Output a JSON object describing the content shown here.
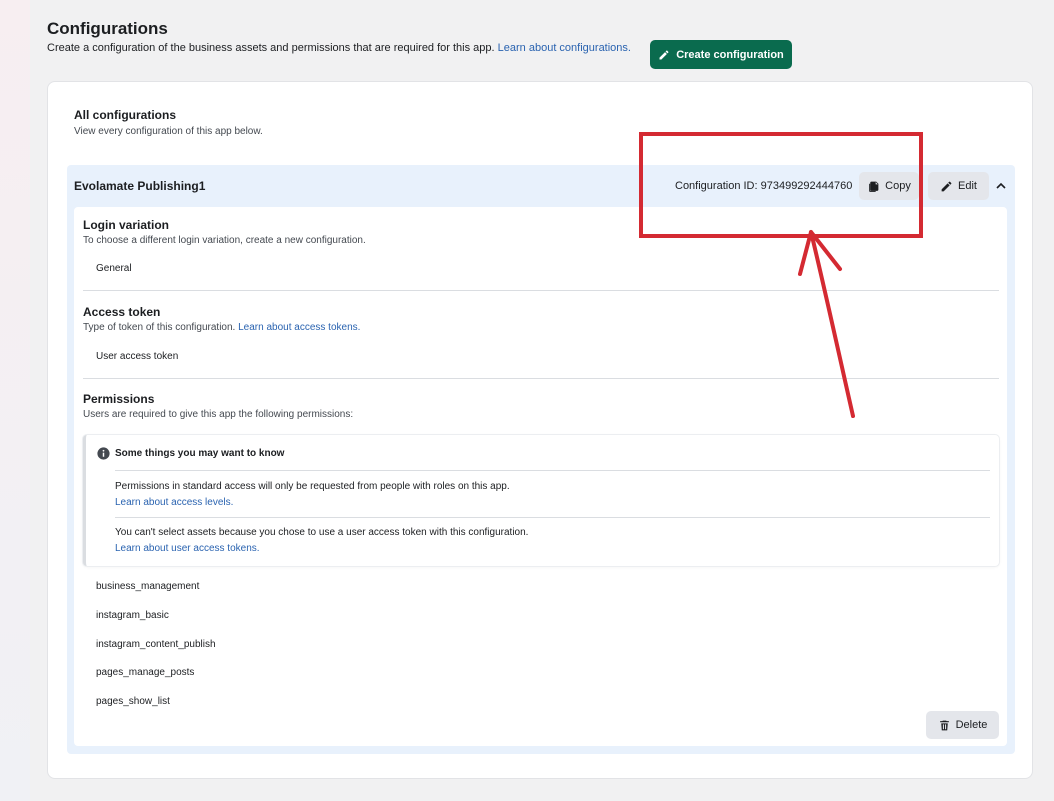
{
  "header": {
    "title": "Configurations",
    "subtitle": "Create a configuration of the business assets and permissions that are required for this app.",
    "subtitle_link": "Learn about configurations.",
    "create_button": "Create configuration"
  },
  "all_configurations": {
    "title": "All configurations",
    "subtitle": "View every configuration of this app below."
  },
  "configuration": {
    "name": "Evolamate Publishing1",
    "id_text": "Configuration ID: 973499292444760",
    "copy_label": "Copy",
    "edit_label": "Edit",
    "login": {
      "title": "Login variation",
      "desc": "To choose a different login variation, create a new configuration.",
      "value": "General"
    },
    "access_token": {
      "title": "Access token",
      "desc": "Type of token of this configuration.",
      "desc_link": "Learn about access tokens.",
      "value": "User access token"
    },
    "permissions": {
      "title": "Permissions",
      "desc": "Users are required to give this app the following permissions:",
      "notice": {
        "title": "Some things you may want to know",
        "item1_text": "Permissions in standard access will only be requested from people with roles on this app.",
        "item1_link": "Learn about access levels.",
        "item2_text": "You can't select assets because you chose to use a user access token with this configuration.",
        "item2_link": "Learn about user access tokens."
      },
      "items": [
        "business_management",
        "instagram_basic",
        "instagram_content_publish",
        "pages_manage_posts",
        "pages_show_list"
      ]
    },
    "delete_label": "Delete"
  },
  "colors": {
    "primary_green": "#0a6b4e",
    "link_blue": "#2a63b0",
    "config_bg": "#e8f1fc",
    "annotation_red": "#d42a32"
  },
  "icons": [
    "pencil-icon",
    "copy-icon",
    "chevron-up-icon",
    "info-icon",
    "trash-icon"
  ]
}
